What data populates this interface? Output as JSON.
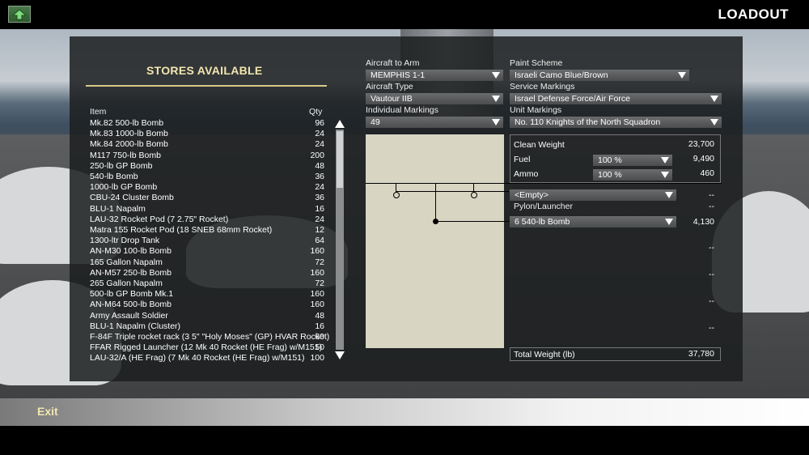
{
  "header": {
    "title": "LOADOUT"
  },
  "stores": {
    "heading": "STORES AVAILABLE",
    "col_item": "Item",
    "col_qty": "Qty",
    "items": [
      {
        "name": "Mk.82 500-lb Bomb",
        "qty": "96"
      },
      {
        "name": "Mk.83 1000-lb Bomb",
        "qty": "24"
      },
      {
        "name": "Mk.84 2000-lb Bomb",
        "qty": "24"
      },
      {
        "name": "M117 750-lb Bomb",
        "qty": "200"
      },
      {
        "name": "250-lb GP Bomb",
        "qty": "48"
      },
      {
        "name": "540-lb Bomb",
        "qty": "36"
      },
      {
        "name": "1000-lb GP Bomb",
        "qty": "24"
      },
      {
        "name": "CBU-24 Cluster Bomb",
        "qty": "36"
      },
      {
        "name": "BLU-1 Napalm",
        "qty": "16"
      },
      {
        "name": "LAU-32 Rocket Pod (7 2.75\" Rocket)",
        "qty": "24"
      },
      {
        "name": "Matra 155 Rocket Pod (18 SNEB 68mm Rocket)",
        "qty": "12"
      },
      {
        "name": "1300-ltr Drop Tank",
        "qty": "64"
      },
      {
        "name": "AN-M30 100-lb Bomb",
        "qty": "160"
      },
      {
        "name": "165 Gallon Napalm",
        "qty": "72"
      },
      {
        "name": "AN-M57 250-lb Bomb",
        "qty": "160"
      },
      {
        "name": "265 Gallon Napalm",
        "qty": "72"
      },
      {
        "name": "500-lb GP Bomb Mk.1",
        "qty": "160"
      },
      {
        "name": "AN-M64 500-lb Bomb",
        "qty": "160"
      },
      {
        "name": "Army Assault Soldier",
        "qty": "48"
      },
      {
        "name": "BLU-1 Napalm (Cluster)",
        "qty": "16"
      },
      {
        "name": "F-84F Triple rocket rack (3 5\" \"Holy Moses\" (GP) HVAR Rocket)",
        "qty": "60"
      },
      {
        "name": "FFAR Rigged Launcher (12 Mk 40 Rocket (HE Frag) w/M151)",
        "qty": "50"
      },
      {
        "name": "LAU-32/A (HE Frag) (7 Mk 40 Rocket (HE Frag) w/M151)",
        "qty": "100"
      }
    ]
  },
  "aircraft": {
    "to_arm_label": "Aircraft to Arm",
    "to_arm_value": "MEMPHIS 1-1",
    "type_label": "Aircraft Type",
    "type_value": "Vautour IIB",
    "markings_label": "Individual Markings",
    "markings_value": "49"
  },
  "livery": {
    "paint_label": "Paint Scheme",
    "paint_value": "Israeli Camo Blue/Brown",
    "service_label": "Service Markings",
    "service_value": "Israel Defense Force/Air Force",
    "unit_label": "Unit Markings",
    "unit_value": "No. 110 Knights of the North Squadron"
  },
  "weights": {
    "clean_label": "Clean Weight",
    "clean_value": "23,700",
    "fuel_label": "Fuel",
    "fuel_pct": "100 %",
    "fuel_value": "9,490",
    "ammo_label": "Ammo",
    "ammo_pct": "100 %",
    "ammo_value": "460",
    "total_label": "Total Weight (lb)",
    "total_value": "37,780"
  },
  "stations": {
    "slot1": "<Empty>",
    "slot1_value": "--",
    "slot1_sub": "Pylon/Launcher",
    "slot1_sub_value": "--",
    "slot2": "6 540-lb Bomb",
    "slot2_value": "4,130",
    "dash3": "--",
    "dash4": "--",
    "dash5": "--",
    "dash6": "--"
  },
  "footer": {
    "exit_label": "Exit"
  },
  "colors": {
    "heading": "#f2e6b0",
    "panel": "#1c1e20"
  }
}
